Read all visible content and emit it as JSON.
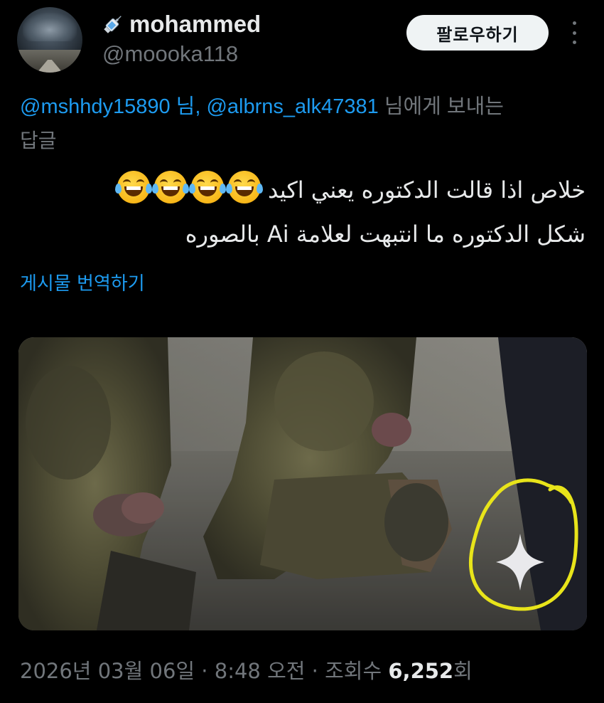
{
  "user": {
    "display_name": "mohammed",
    "handle": "@moooka118",
    "name_emoji": "syringe-icon"
  },
  "follow_label": "팔로우하기",
  "reply_context": {
    "mention_1": "@mshhdy15890",
    "separator_1": " 님, ",
    "mention_2": "@albrns_alk47381",
    "suffix": " 님에게 보내는",
    "line2": "답글"
  },
  "tweet": {
    "line1": "خلاص اذا قالت الدكتوره يعني اكيد",
    "line1_emoji": "face-with-tears-of-joy-icon",
    "line1_emoji_count": 4,
    "line2": "شكل الدكتوره ما انتبهت لعلامة Ai بالصوره"
  },
  "translate_label": "게시물 번역하기",
  "media": {
    "description_icon": "ai-sparkle-icon",
    "highlight_color": "#e8e41a"
  },
  "meta": {
    "date": "2026년 03월 06일",
    "sep1": " · ",
    "time": "8:48 오전",
    "sep2": " · ",
    "views_label": "조회수 ",
    "views_count": "6,252",
    "views_suffix": "회"
  },
  "colors": {
    "background": "#000000",
    "text": "#e7e9ea",
    "muted": "#71767b",
    "link": "#1d9bf0"
  }
}
